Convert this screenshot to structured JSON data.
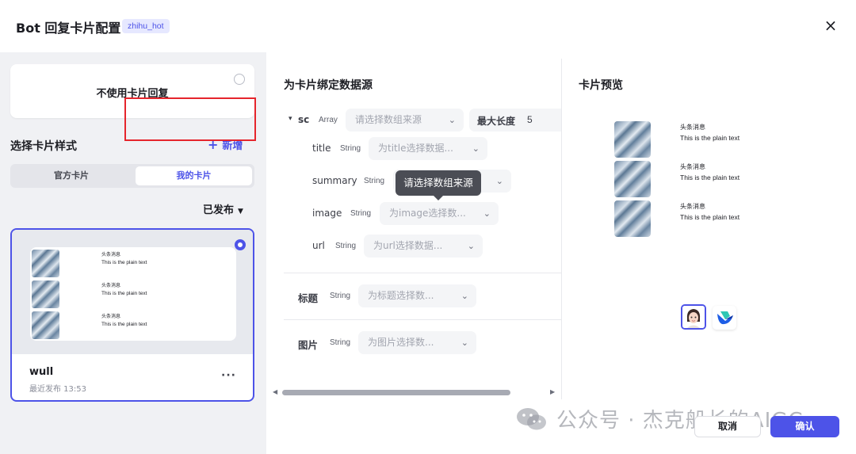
{
  "header": {
    "title": "Bot 回复卡片配置",
    "tag": "zhihu_hot",
    "close_icon": "×"
  },
  "left": {
    "no_card_label": "不使用卡片回复",
    "section_title": "选择卡片样式",
    "add_icon": "+",
    "add_label": "新增",
    "tabs": [
      {
        "label": "官方卡片"
      },
      {
        "label": "我的卡片"
      }
    ],
    "published_label": "已发布",
    "caret": "▼",
    "card": {
      "items": [
        {
          "head": "头条消息",
          "text": "This is the plain text"
        },
        {
          "head": "头条消息",
          "text": "This is the plain text"
        },
        {
          "head": "头条消息",
          "text": "This is the plain text"
        }
      ],
      "name": "wull",
      "sub": "最近发布 13:53",
      "more": "···"
    }
  },
  "mid": {
    "title": "为卡片绑定数据源",
    "array_field": {
      "expand_icon": "▾",
      "name": "sc",
      "type": "Array",
      "placeholder": "请选择数组来源",
      "max_len_label": "最大长度",
      "max_len_value": "5"
    },
    "fields": [
      {
        "name": "title",
        "type": "String",
        "placeholder": "为title选择数据..."
      },
      {
        "name": "summary",
        "type": "String",
        "placeholder": ""
      },
      {
        "name": "image",
        "type": "String",
        "placeholder": "为image选择数..."
      },
      {
        "name": "url",
        "type": "String",
        "placeholder": "为url选择数据..."
      }
    ],
    "tooltip": "请选择数组来源",
    "title_field": {
      "name": "标题",
      "type": "String",
      "placeholder": "为标题选择数..."
    },
    "image_field": {
      "name": "图片",
      "type": "String",
      "placeholder": "为图片选择数..."
    },
    "chevron": "⌄",
    "scroll_left": "◀",
    "scroll_right": "▶"
  },
  "right": {
    "title": "卡片预览",
    "items": [
      {
        "head": "头条消息",
        "text": "This is the plain text"
      },
      {
        "head": "头条消息",
        "text": "This is the plain text"
      },
      {
        "head": "头条消息",
        "text": "This is the plain text"
      }
    ]
  },
  "footer": {
    "watermark": "公众号 · 杰克船长的AIGC",
    "cancel": "取消",
    "confirm": "确认"
  },
  "colors": {
    "accent": "#4d53e8",
    "highlight": "#e5252c",
    "panel": "#f0f1f4"
  }
}
